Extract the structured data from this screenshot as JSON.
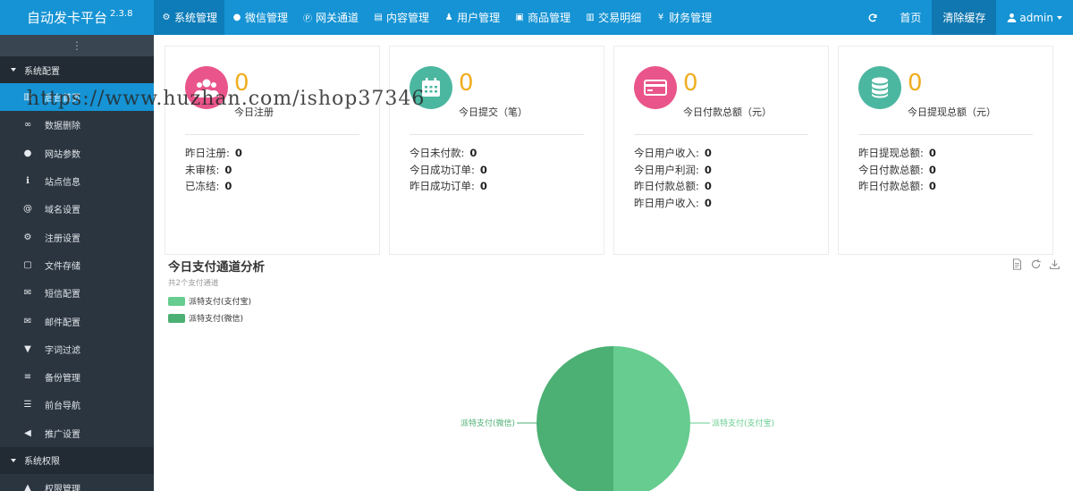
{
  "app": {
    "title": "自动发卡平台",
    "version": "2.3.8"
  },
  "topnav": [
    {
      "label": "系统管理",
      "icon": "gear-icon",
      "active": true
    },
    {
      "label": "微信管理",
      "icon": "wechat-icon"
    },
    {
      "label": "网关通道",
      "icon": "p-circle-icon"
    },
    {
      "label": "内容管理",
      "icon": "file-icon"
    },
    {
      "label": "用户管理",
      "icon": "users-icon"
    },
    {
      "label": "商品管理",
      "icon": "shop-icon"
    },
    {
      "label": "交易明细",
      "icon": "bar-chart-icon"
    },
    {
      "label": "财务管理",
      "icon": "money-icon"
    }
  ],
  "topright": {
    "home": "首页",
    "clear_cache": "清除缓存",
    "user": "admin"
  },
  "sidebar": {
    "group1": "系统配置",
    "items": [
      {
        "label": "后台首页",
        "icon": "chart-icon",
        "active": true
      },
      {
        "label": "数据删除",
        "icon": "link-icon"
      },
      {
        "label": "网站参数",
        "icon": "apple-icon"
      },
      {
        "label": "站点信息",
        "icon": "info-icon"
      },
      {
        "label": "域名设置",
        "icon": "at-icon"
      },
      {
        "label": "注册设置",
        "icon": "cog-icon"
      },
      {
        "label": "文件存储",
        "icon": "save-icon"
      },
      {
        "label": "短信配置",
        "icon": "envelope-icon"
      },
      {
        "label": "邮件配置",
        "icon": "mail-icon"
      },
      {
        "label": "字词过滤",
        "icon": "filter-icon"
      },
      {
        "label": "备份管理",
        "icon": "database-icon"
      },
      {
        "label": "前台导航",
        "icon": "list-icon"
      },
      {
        "label": "推广设置",
        "icon": "bullhorn-icon"
      }
    ],
    "group2": "系统权限",
    "items2": [
      {
        "label": "权限管理",
        "icon": "lock-icon"
      }
    ]
  },
  "cards": [
    {
      "value": "0",
      "label": "今日注册",
      "color": "#e9558a",
      "stats": [
        {
          "k": "昨日注册:",
          "v": "0"
        },
        {
          "k": "未审核:",
          "v": "0"
        },
        {
          "k": "已冻结:",
          "v": "0"
        }
      ]
    },
    {
      "value": "0",
      "label": "今日提交（笔）",
      "color": "#4cb7a0",
      "stats": [
        {
          "k": "今日未付款:",
          "v": "0"
        },
        {
          "k": "今日成功订单:",
          "v": "0"
        },
        {
          "k": "昨日成功订单:",
          "v": "0"
        }
      ]
    },
    {
      "value": "0",
      "label": "今日付款总额（元）",
      "color": "#e9558a",
      "stats": [
        {
          "k": "今日用户收入:",
          "v": "0"
        },
        {
          "k": "今日用户利润:",
          "v": "0"
        },
        {
          "k": "昨日付款总额:",
          "v": "0"
        },
        {
          "k": "昨日用户收入:",
          "v": "0"
        }
      ]
    },
    {
      "value": "0",
      "label": "今日提现总额（元）",
      "color": "#4cb7a0",
      "stats": [
        {
          "k": "昨日提现总额:",
          "v": "0"
        },
        {
          "k": "今日付款总额:",
          "v": "0"
        },
        {
          "k": "昨日付款总额:",
          "v": "0"
        }
      ]
    }
  ],
  "chart_data": {
    "type": "pie",
    "title": "今日支付通道分析",
    "subtitle": "共2个支付通道",
    "legend_position": "top-left",
    "series": [
      {
        "name": "派特支付(支付宝)",
        "value": 1,
        "color": "#66cc8f"
      },
      {
        "name": "派特支付(微信)",
        "value": 1,
        "color": "#4caf73"
      }
    ]
  },
  "watermark": "https://www.huzhan.com/ishop37346"
}
